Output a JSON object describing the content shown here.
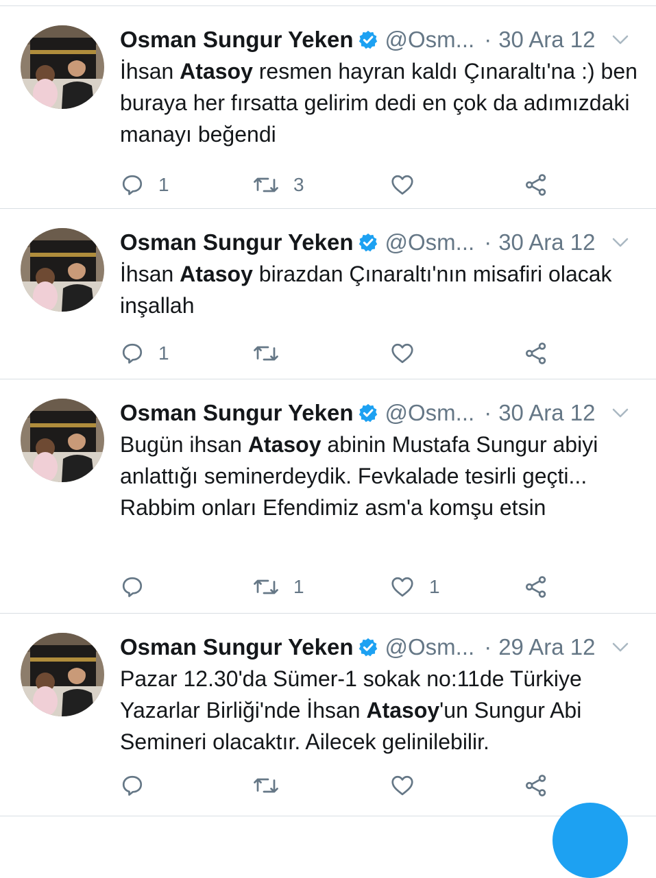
{
  "colors": {
    "text": "#14171a",
    "secondary": "#657786",
    "verified": "#1da1f2",
    "divider": "#d8dee3"
  },
  "icons": {
    "reply": "reply-icon",
    "retweet": "retweet-icon",
    "like": "heart-icon",
    "share": "share-icon",
    "verified": "verified-badge-icon",
    "menu": "chevron-down-icon"
  },
  "tweets": [
    {
      "name": "Osman Sungur Yeken",
      "handle": "@Osm...",
      "separator": "·",
      "date": "30 Ara 12",
      "text_1": "İhsan ",
      "text_2": "Atasoy",
      "text_3": " resmen hayran kaldı Çınaraltı'na :) ben buraya her fırsatta gelirim dedi en çok da adımızdaki manayı beğendi",
      "replies": "1",
      "retweets": "3",
      "likes": ""
    },
    {
      "name": "Osman Sungur Yeken",
      "handle": "@Osm...",
      "separator": "·",
      "date": "30 Ara 12",
      "text_1": "İhsan ",
      "text_2": "Atasoy",
      "text_3": " birazdan Çınaraltı'nın misafiri olacak inşallah",
      "replies": "1",
      "retweets": "",
      "likes": ""
    },
    {
      "name": "Osman Sungur Yeken",
      "handle": "@Osm...",
      "separator": "·",
      "date": "30 Ara 12",
      "text_1": "Bugün ihsan ",
      "text_2": "Atasoy",
      "text_3": " abinin Mustafa Sungur abiyi anlattığı seminerdeydik. Fevkalade tesirli geçti... Rabbim onları Efendimiz asm'a komşu etsin",
      "replies": "",
      "retweets": "1",
      "likes": "1"
    },
    {
      "name": "Osman Sungur Yeken",
      "handle": "@Osm...",
      "separator": "·",
      "date": "29 Ara 12",
      "text_1": "Pazar 12.30'da Sümer-1 sokak no:11de Türkiye Yazarlar Birliği'nde İhsan ",
      "text_2": "Atasoy",
      "text_3": "'un Sungur Abi Semineri olacaktır. Ailecek gelinilebilir.",
      "replies": "",
      "retweets": "",
      "likes": ""
    }
  ]
}
